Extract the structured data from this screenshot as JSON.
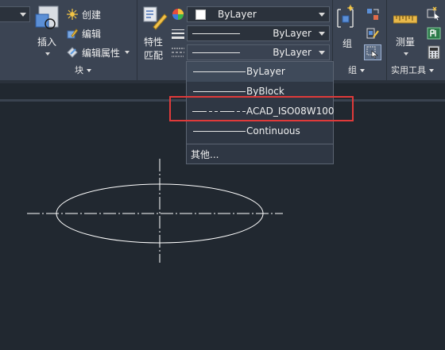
{
  "ribbon": {
    "insert_label": "插入",
    "block_panel": {
      "title": "块",
      "create": "创建",
      "edit": "编辑",
      "edit_attributes": "编辑属性"
    },
    "match_properties_label": "特性\n匹配",
    "match_line1": "特性",
    "match_line2": "匹配",
    "properties": {
      "color_value": "ByLayer",
      "lineweight_value": "ByLayer",
      "linetype_value": "ByLayer"
    },
    "group_panel": {
      "group_label": "组",
      "title": "组"
    },
    "utilities_panel": {
      "measure_label": "测量",
      "title": "实用工具"
    }
  },
  "linetype_dropdown": {
    "items": [
      {
        "label": "ByLayer",
        "style": "solid"
      },
      {
        "label": "ByBlock",
        "style": "solid"
      },
      {
        "label": "ACAD_ISO08W100",
        "style": "dashdot"
      },
      {
        "label": "Continuous",
        "style": "solid"
      }
    ],
    "other": "其他..."
  },
  "colors": {
    "ribbon_bg": "#3b4453",
    "canvas_bg": "#212830",
    "highlight": "#e03a3a"
  }
}
